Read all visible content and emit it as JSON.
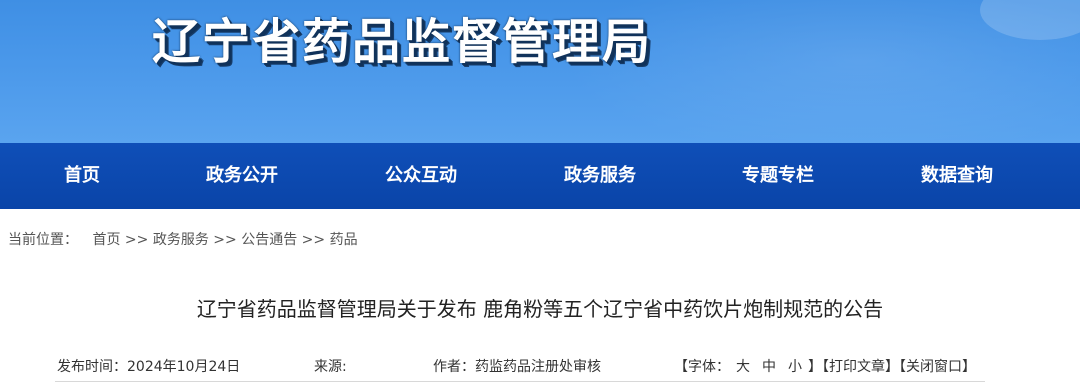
{
  "header": {
    "title": "辽宁省药品监督管理局"
  },
  "nav": {
    "items": [
      {
        "label": "首页"
      },
      {
        "label": "政务公开"
      },
      {
        "label": "公众互动"
      },
      {
        "label": "政务服务"
      },
      {
        "label": "专题专栏"
      },
      {
        "label": "数据查询"
      }
    ]
  },
  "breadcrumb": {
    "prefix": "当前位置：",
    "separator": ">>",
    "items": [
      "首页",
      "政务服务",
      "公告通告",
      "药品"
    ]
  },
  "article": {
    "title": "辽宁省药品监督管理局关于发布 鹿角粉等五个辽宁省中药饮片炮制规范的公告",
    "publish_label": "发布时间：",
    "publish_date": "2024年10月24日",
    "source_label": "来源:",
    "source_value": "",
    "author_label": "作者：",
    "author_value": "药监药品注册处审核"
  },
  "tools": {
    "font_open": "【字体：",
    "font_large": "大",
    "font_medium": "中",
    "font_small": "小",
    "font_close": "】",
    "print": "【打印文章】",
    "close_window": "【关闭窗口】"
  },
  "colors": {
    "banner": "#4a98ea",
    "nav": "#0c48ae",
    "nav_text": "#ffffff"
  }
}
